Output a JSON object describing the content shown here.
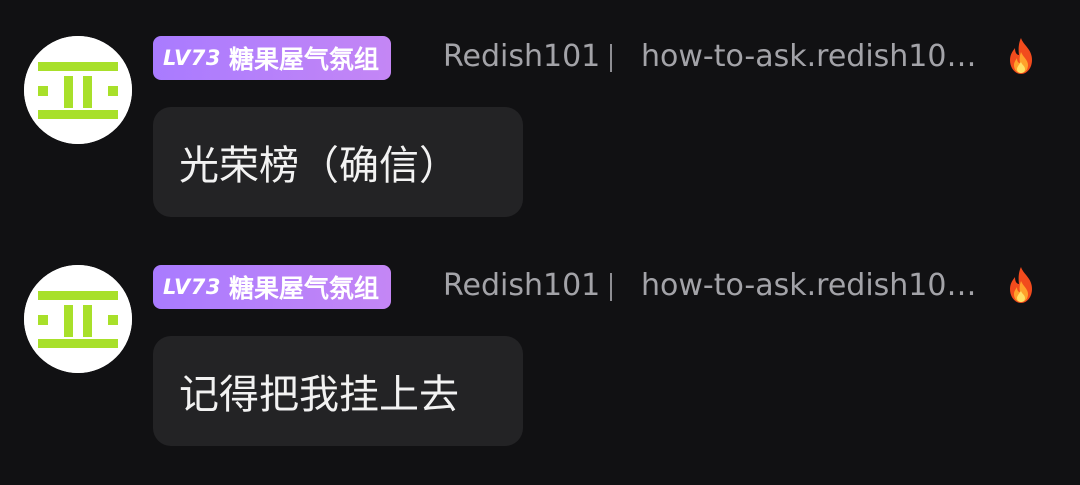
{
  "messages": [
    {
      "level": "LV73",
      "group": "糖果屋气氛组",
      "username": "Redish101",
      "note": "how-to-ask.redish10…",
      "text": "光荣榜（确信）",
      "icon": "fire-icon",
      "avatar": "avatar-icon"
    },
    {
      "level": "LV73",
      "group": "糖果屋气氛组",
      "username": "Redish101",
      "note": "how-to-ask.redish10…",
      "text": "记得把我挂上去",
      "icon": "fire-icon",
      "avatar": "avatar-icon"
    }
  ],
  "colors": {
    "background": "#111113",
    "bubble": "#232325",
    "badge_start": "#a97bff",
    "badge_end": "#c486f5",
    "avatar_green": "#a8e02a",
    "meta_text": "#a3a3a8"
  }
}
